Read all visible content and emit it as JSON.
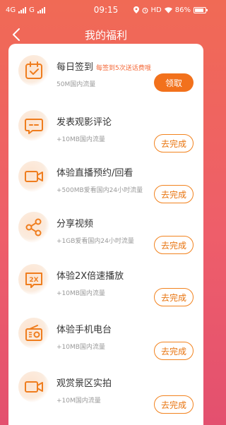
{
  "status_bar": {
    "left": "4G",
    "left2": "G",
    "time": "09:15",
    "right_hd": "HD",
    "battery": "86%",
    "battery_level": 0.86
  },
  "nav": {
    "back_icon": "chevron-left-icon",
    "title": "我的福利"
  },
  "tasks": [
    {
      "title": "每日签到",
      "promo": "每签到5次送话费哦",
      "desc": "50M国内流量",
      "button": "领取",
      "icon": "calendar-check-icon"
    },
    {
      "title": "发表观影评论",
      "desc": "+10MB国内流量",
      "button": "去完成",
      "icon": "comment-icon"
    },
    {
      "title": "体验直播预约/回看",
      "desc": "+500MB爱看国内24小时流量",
      "button": "去完成",
      "icon": "video-camera-icon"
    },
    {
      "title": "分享视频",
      "desc": "+1GB爱看国内24小时流量",
      "button": "去完成",
      "icon": "share-icon"
    },
    {
      "title": "体验2X倍速播放",
      "desc": "+10MB国内流量",
      "button": "去完成",
      "icon": "speed-2x-icon"
    },
    {
      "title": "体验手机电台",
      "desc": "+10MB国内流量",
      "button": "去完成",
      "icon": "radio-icon"
    },
    {
      "title": "观赏景区实拍",
      "desc": "+10M国内流量",
      "button": "去完成",
      "icon": "video-camera-icon"
    }
  ],
  "colors": {
    "accent": "#f2711c",
    "header_bg": "#f06a55",
    "icon": "#ef7d1e"
  }
}
